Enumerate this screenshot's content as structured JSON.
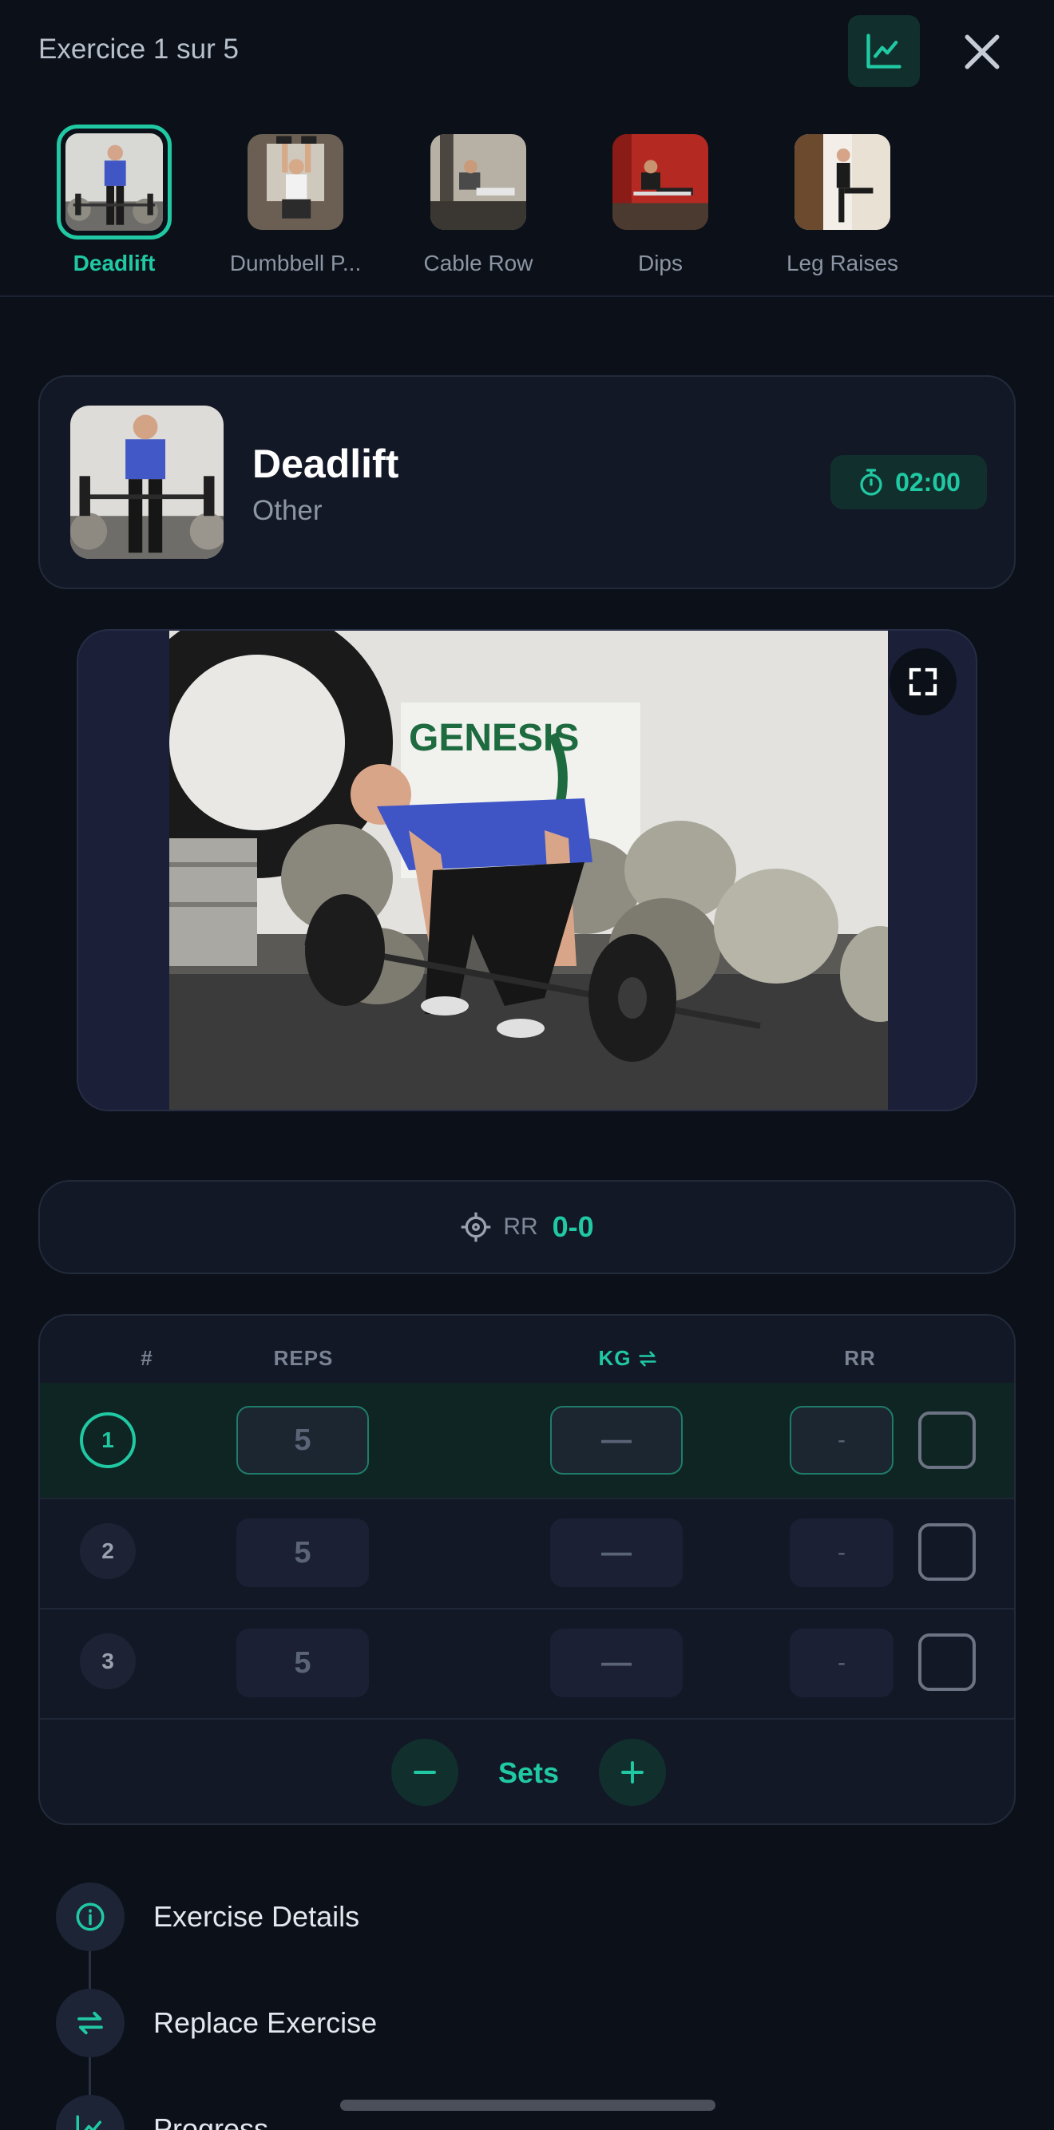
{
  "header": {
    "title": "Exercice 1 sur 5"
  },
  "exercises": [
    {
      "label": "Deadlift",
      "active": true
    },
    {
      "label": "Dumbbell P...",
      "active": false
    },
    {
      "label": "Cable Row",
      "active": false
    },
    {
      "label": "Dips",
      "active": false
    },
    {
      "label": "Leg Raises",
      "active": false
    }
  ],
  "current": {
    "name": "Deadlift",
    "category": "Other",
    "timer": "02:00"
  },
  "target": {
    "label": "RR",
    "value": "0-0"
  },
  "table": {
    "headers": {
      "num": "#",
      "reps": "REPS",
      "kg": "KG",
      "rr": "RR"
    },
    "rows": [
      {
        "num": "1",
        "reps": "5",
        "kg": "—",
        "rr": "-",
        "active": true
      },
      {
        "num": "2",
        "reps": "5",
        "kg": "—",
        "rr": "-",
        "active": false
      },
      {
        "num": "3",
        "reps": "5",
        "kg": "—",
        "rr": "-",
        "active": false
      }
    ],
    "sets_label": "Sets"
  },
  "links": [
    {
      "label": "Exercise Details",
      "icon": "info-icon"
    },
    {
      "label": "Replace Exercise",
      "icon": "swap-icon"
    },
    {
      "label": "Progress",
      "icon": "chart-icon"
    }
  ],
  "colors": {
    "accent": "#20c9a3",
    "background": "#0b1019",
    "card": "#121826"
  }
}
